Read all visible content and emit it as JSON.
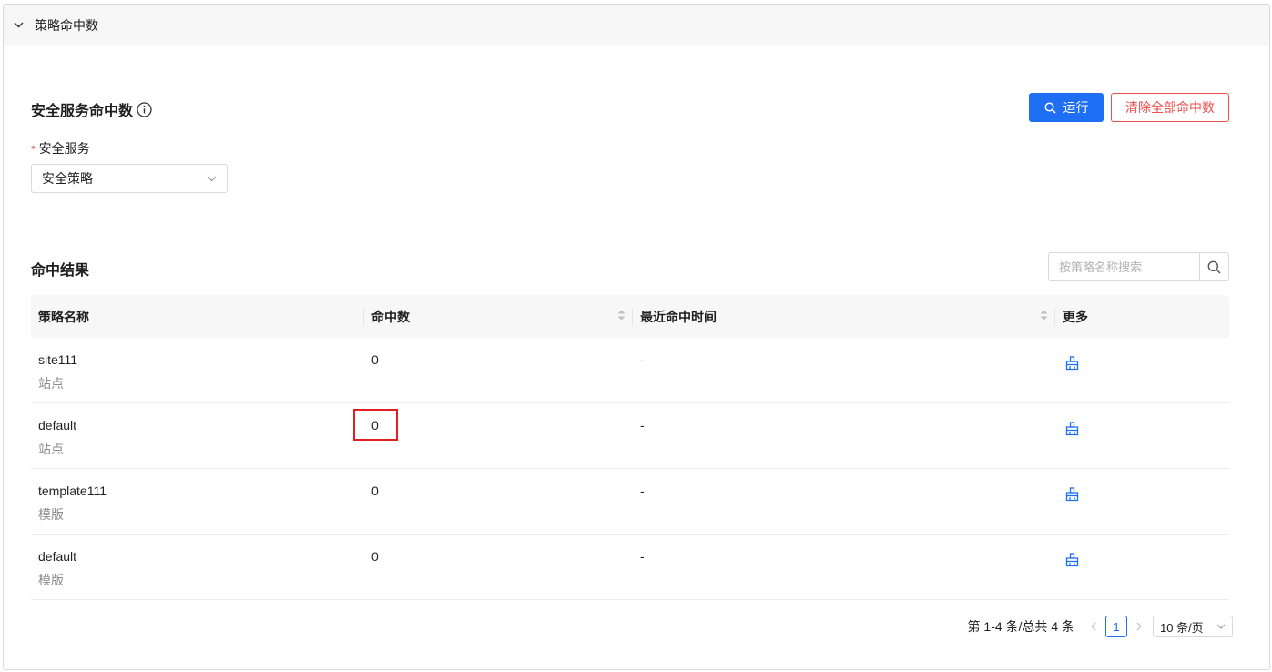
{
  "panel": {
    "title": "策略命中数"
  },
  "section": {
    "title": "安全服务命中数"
  },
  "toolbar": {
    "run_label": "运行",
    "clear_label": "清除全部命中数"
  },
  "form": {
    "service_label": "安全服务",
    "required_mark": "*",
    "service_value": "安全策略"
  },
  "results": {
    "title": "命中结果",
    "search_placeholder": "按策略名称搜索",
    "columns": [
      "策略名称",
      "命中数",
      "最近命中时间",
      "更多"
    ],
    "rows": [
      {
        "name": "site111",
        "type": "站点",
        "hits": "0",
        "last_hit": "-"
      },
      {
        "name": "default",
        "type": "站点",
        "hits": "0",
        "last_hit": "-"
      },
      {
        "name": "template111",
        "type": "模版",
        "hits": "0",
        "last_hit": "-"
      },
      {
        "name": "default",
        "type": "模版",
        "hits": "0",
        "last_hit": "-"
      }
    ]
  },
  "pagination": {
    "summary": "第 1-4 条/总共 4 条",
    "current_page": "1",
    "page_size": "10 条/页"
  },
  "colors": {
    "primary": "#1f6ff5",
    "danger": "#f04d4d",
    "highlight": "#e02020"
  },
  "icons": [
    "chevron-down-icon",
    "info-icon",
    "search-icon",
    "clear-broom-icon",
    "chevron-left-icon",
    "chevron-right-icon"
  ]
}
